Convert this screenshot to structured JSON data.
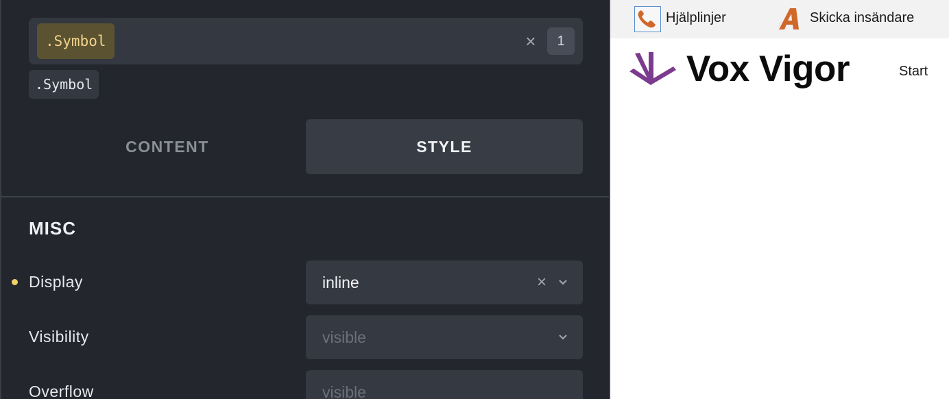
{
  "editor": {
    "selector": {
      "active_tag": ".Symbol",
      "clear_glyph": "×",
      "count": "1"
    },
    "class_chip": ".Symbol",
    "tabs": [
      {
        "label": "CONTENT",
        "selected": false
      },
      {
        "label": "STYLE",
        "selected": true
      }
    ],
    "section": {
      "title": "MISC",
      "properties": [
        {
          "label": "Display",
          "value": "inline",
          "is_set": true,
          "clear_glyph": "×"
        },
        {
          "label": "Visibility",
          "value": "visible",
          "is_set": false
        },
        {
          "label": "Overflow",
          "value": "visible",
          "is_set": false
        }
      ]
    },
    "colors": {
      "panel_bg": "#23262c",
      "field_bg": "#353942",
      "tag_bg": "#5b5232",
      "tag_text": "#f1d48a",
      "set_indicator": "#f1d06a"
    }
  },
  "preview": {
    "topbar": {
      "help_icon": "phone-icon",
      "help_label": "Hjälplinjer",
      "submit_icon": "letter-a-icon",
      "submit_label": "Skicka insändare"
    },
    "logo": {
      "icon": "arrows-down-icon",
      "text": "Vox Vigor"
    },
    "nav": {
      "start_label": "Start"
    },
    "colors": {
      "logo_mark": "#7b3b8e",
      "accent_orange": "#d0682a",
      "topbar_bg": "#f2f2f2"
    }
  }
}
